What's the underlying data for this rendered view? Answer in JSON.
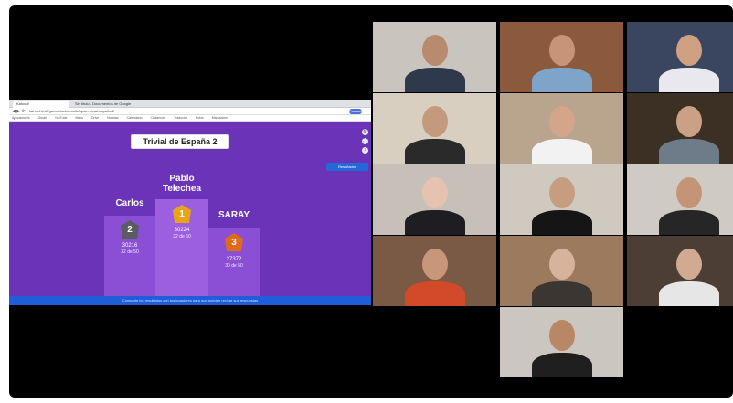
{
  "browser": {
    "tabs": [
      "Kahoot!",
      "Sin título - Documentos de Google"
    ],
    "url": "kahoot.it/v2/gameblock/results?quiz=trivial-españa-2",
    "profile_label": "Pausada",
    "bookmarks": [
      "Aplicaciones",
      "Gmail",
      "YouTube",
      "Maps",
      "Drive",
      "Noticias",
      "Calendario",
      "Classroom",
      "Traductor",
      "Fotos",
      "Marcadores"
    ]
  },
  "quiz": {
    "title": "Trivial de España 2",
    "results_button": "Resultados",
    "footer_text": "Comparte los resultados con tus jugadores para que puedan revisar sus respuestas"
  },
  "podium": [
    {
      "place": "1",
      "name": "Pablo\nTelechea",
      "score": "30224",
      "correct": "32 de 50",
      "color": "#e7a514"
    },
    {
      "place": "2",
      "name": "Carlos",
      "score": "30216",
      "correct": "32 de 50",
      "color": "#5b5b63"
    },
    {
      "place": "3",
      "name": "SARAY",
      "score": "27372",
      "correct": "30 de 50",
      "color": "#e06a1a"
    }
  ],
  "participants": [
    {
      "bg": "#c9c4bd",
      "skin": "#b98b6e",
      "shirt": "#2e3a4c"
    },
    {
      "bg": "#8b5a3c",
      "skin": "#c89478",
      "shirt": "#7ea5c9"
    },
    {
      "bg": "#3a4660",
      "skin": "#d0a083",
      "shirt": "#e8e8ee"
    },
    {
      "bg": "#d9cfc0",
      "skin": "#c39a7e",
      "shirt": "#2a2a2a"
    },
    {
      "bg": "#b9a48e",
      "skin": "#d4a58b",
      "shirt": "#f2f2f2"
    },
    {
      "bg": "#3c2f24",
      "skin": "#caa184",
      "shirt": "#6e7c8a"
    },
    {
      "bg": "#c6c0b8",
      "skin": "#e5c3b0",
      "shirt": "#1e1e22"
    },
    {
      "bg": "#d0c9c0",
      "skin": "#c79d80",
      "shirt": "#151515"
    },
    {
      "bg": "#cfcac3",
      "skin": "#c49477",
      "shirt": "#262626"
    },
    {
      "bg": "#7a5a44",
      "skin": "#c89678",
      "shirt": "#d24a2a"
    },
    {
      "bg": "#9c7a5e",
      "skin": "#d8b39c",
      "shirt": "#3b3632"
    },
    {
      "bg": "#4c3e34",
      "skin": "#d2a992",
      "shirt": "#e6e6e6"
    },
    {
      "bg": "#cbc6bf",
      "skin": "#b88766",
      "shirt": "#1f1f1f"
    },
    {
      "bg": "#b34b4f",
      "skin": "#d5ab92",
      "shirt": "#2a2422"
    }
  ]
}
